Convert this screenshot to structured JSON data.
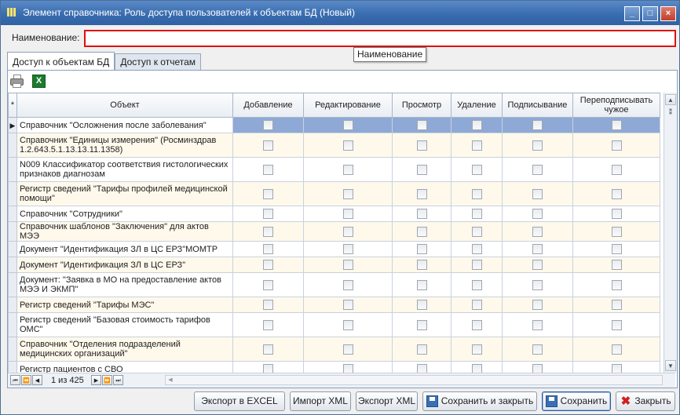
{
  "window": {
    "title": "Элемент справочника: Роль доступа пользователей к объектам БД (Новый)",
    "controls": {
      "minimize": "_",
      "maximize": "□",
      "close": "×"
    }
  },
  "name_field": {
    "label": "Наименование:",
    "value": "",
    "tooltip": "Наименование"
  },
  "tabs": [
    {
      "label": "Доступ к объектам БД",
      "active": true
    },
    {
      "label": "Доступ к отчетам",
      "active": false
    }
  ],
  "toolbar": {
    "print_icon": "printer-icon",
    "excel_icon": "excel-icon",
    "excel_glyph": "X"
  },
  "grid": {
    "indicator_header": "*",
    "columns": [
      "Объект",
      "Добавление",
      "Редактирование",
      "Просмотр",
      "Удаление",
      "Подписывание",
      "Переподписывать чужое"
    ],
    "rows": [
      {
        "object": "Справочник \"Осложнения после заболевания\"",
        "selected": true
      },
      {
        "object": "Справочник \"Единицы измерения\" (Росминздрав 1.2.643.5.1.13.13.11.1358)"
      },
      {
        "object": "N009 Классификатор соответствия гистологических признаков диагнозам"
      },
      {
        "object": "Регистр сведений \"Тарифы профилей медицинской помощи\""
      },
      {
        "object": "Справочник \"Сотрудники\""
      },
      {
        "object": "Справочник шаблонов \"Заключения\" для актов МЭЭ"
      },
      {
        "object": "Документ \"Идентификация ЗЛ в ЦС ЕРЗ\"МОМТР"
      },
      {
        "object": "Документ \"Идентификация ЗЛ в ЦС ЕРЗ\""
      },
      {
        "object": "Документ: \"Заявка в МО на предоставление актов МЭЭ И ЭКМП\""
      },
      {
        "object": "Регистр сведений \"Тарифы МЭС\""
      },
      {
        "object": "Регистр сведений \"Базовая стоимость тарифов ОМС\""
      },
      {
        "object": "Справочник \"Отделения подразделений медицинских организаций\""
      },
      {
        "object": "Регистр пациентов с СВО"
      }
    ],
    "selected_marker": "▶"
  },
  "pager": {
    "first": "|◀◀",
    "prev_page": "◀◀",
    "prev": "◀",
    "info": "1 из 425",
    "next": "▶",
    "next_page": "▶▶",
    "last": "▶▶|"
  },
  "buttons": {
    "export_excel": "Экспорт в EXCEL",
    "import_xml": "Импорт XML",
    "export_xml": "Экспорт XML",
    "save_close": "Сохранить и закрыть",
    "save": "Сохранить",
    "close": "Закрыть"
  }
}
